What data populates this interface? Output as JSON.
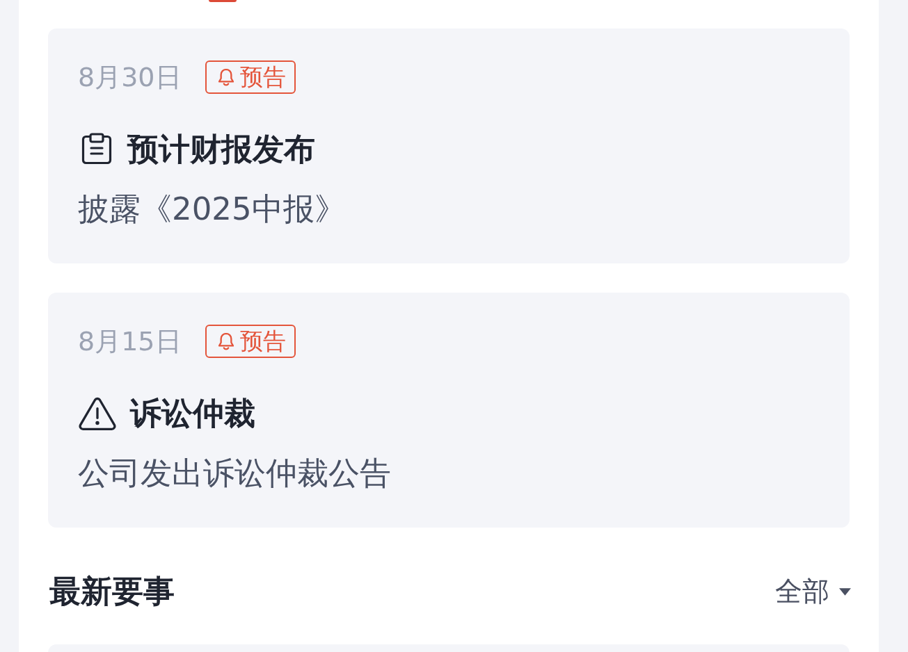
{
  "events": [
    {
      "date": "8月30日",
      "badge": "预告",
      "kind": "report",
      "title": "预计财报发布",
      "description": "披露《2025中报》"
    },
    {
      "date": "8月15日",
      "badge": "预告",
      "kind": "warning",
      "title": "诉讼仲裁",
      "description": "公司发出诉讼仲裁公告"
    }
  ],
  "section": {
    "title": "最新要事",
    "filter": "全部"
  }
}
